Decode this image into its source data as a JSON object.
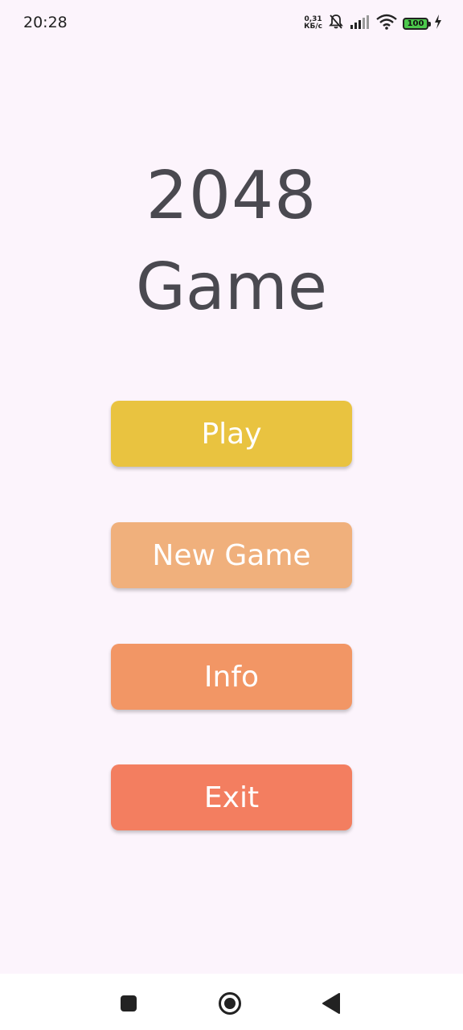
{
  "status_bar": {
    "time": "20:28",
    "net_speed_value": "0,31",
    "net_speed_unit": "КБ/с",
    "battery_level": "100",
    "icons": [
      "mute-bell-icon",
      "signal-icon",
      "wifi-icon",
      "battery-icon",
      "charging-bolt-icon"
    ]
  },
  "title": {
    "line1": "2048",
    "line2": "Game"
  },
  "menu": [
    {
      "label": "Play",
      "color": "#e9c340"
    },
    {
      "label": "New Game",
      "color": "#f0b07c"
    },
    {
      "label": "Info",
      "color": "#f29665"
    },
    {
      "label": "Exit",
      "color": "#f37e60"
    }
  ],
  "nav_bar": {
    "icons": [
      "recents-square-icon",
      "home-circle-icon",
      "back-triangle-icon"
    ]
  },
  "colors": {
    "background": "#fcf4fc",
    "title_text": "#4a4950"
  }
}
